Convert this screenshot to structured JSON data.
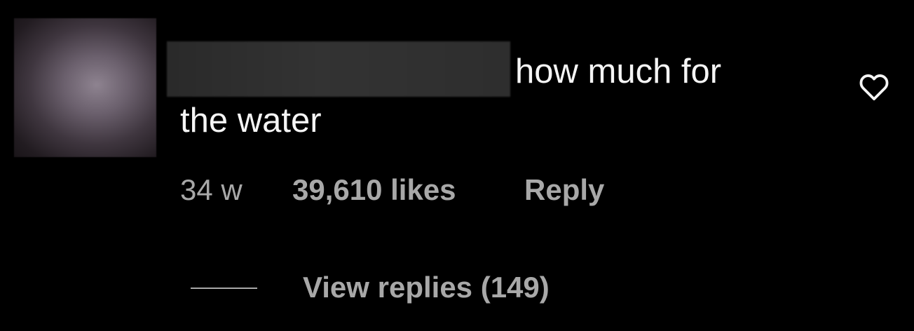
{
  "comment": {
    "text_line1": "how much for",
    "text_line2": "the water",
    "timestamp": "34 w",
    "likes": "39,610 likes",
    "reply_label": "Reply",
    "view_replies_label": "View replies (149)",
    "like_icon": "heart-outline-icon"
  },
  "colors": {
    "background": "#000000",
    "primary_text": "#f5f5f5",
    "secondary_text": "#a8a8a8"
  }
}
